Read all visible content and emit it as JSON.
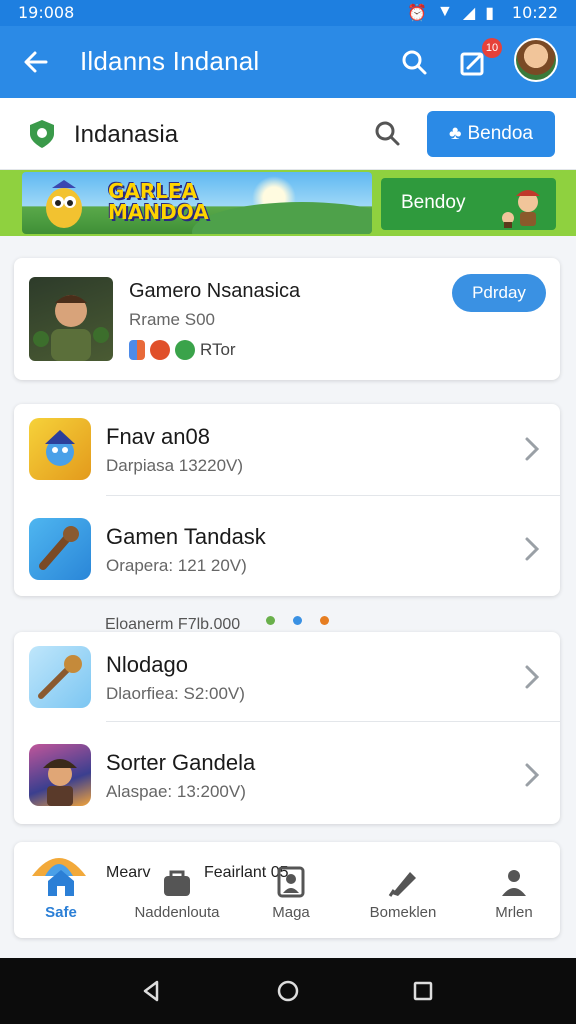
{
  "status_bar": {
    "time_left": "19:008",
    "time_right": "10:22"
  },
  "app_bar": {
    "title": "Ildanns Indanal",
    "badge": "10"
  },
  "search_card": {
    "label": "Indanasia",
    "button_label": "Bendoa"
  },
  "banner": {
    "title_line1": "GARLEA",
    "title_line2": "MANDOA",
    "play_button": "Bendoy"
  },
  "featured": {
    "title": "Gamero Nsanasica",
    "subtitle": "Rrame S00",
    "meta_text": "RTor",
    "button_label": "Pdrday"
  },
  "list_group_1": [
    {
      "name": "Fnav an08",
      "desc": "Darpiasa 13220V)"
    },
    {
      "name": "Gamen Tandask",
      "desc": "Orapera: 121 20V)"
    }
  ],
  "section_label": "Eloanerm F7lb.000",
  "list_group_2": [
    {
      "name": "Nlodago",
      "desc": "Dlaorfiea: S2:00V)"
    },
    {
      "name": "Sorter Gandela",
      "desc": "Alaspae: 13:200V)"
    }
  ],
  "bottom_nav": {
    "heading_left": "Mearv",
    "heading_right": "Feairlant  05",
    "items": [
      {
        "label": "Safe",
        "icon": "home-icon"
      },
      {
        "label": "Naddenlouta",
        "icon": "bag-icon"
      },
      {
        "label": "Maga",
        "icon": "portrait-icon"
      },
      {
        "label": "Bomeklen",
        "icon": "pen-icon"
      },
      {
        "label": "Mrlen",
        "icon": "person-icon"
      }
    ]
  },
  "colors": {
    "primary": "#2b8ae6",
    "banner_green": "#8fd13f",
    "play_green": "#2f9a3d",
    "badge_red": "#e6413a"
  }
}
